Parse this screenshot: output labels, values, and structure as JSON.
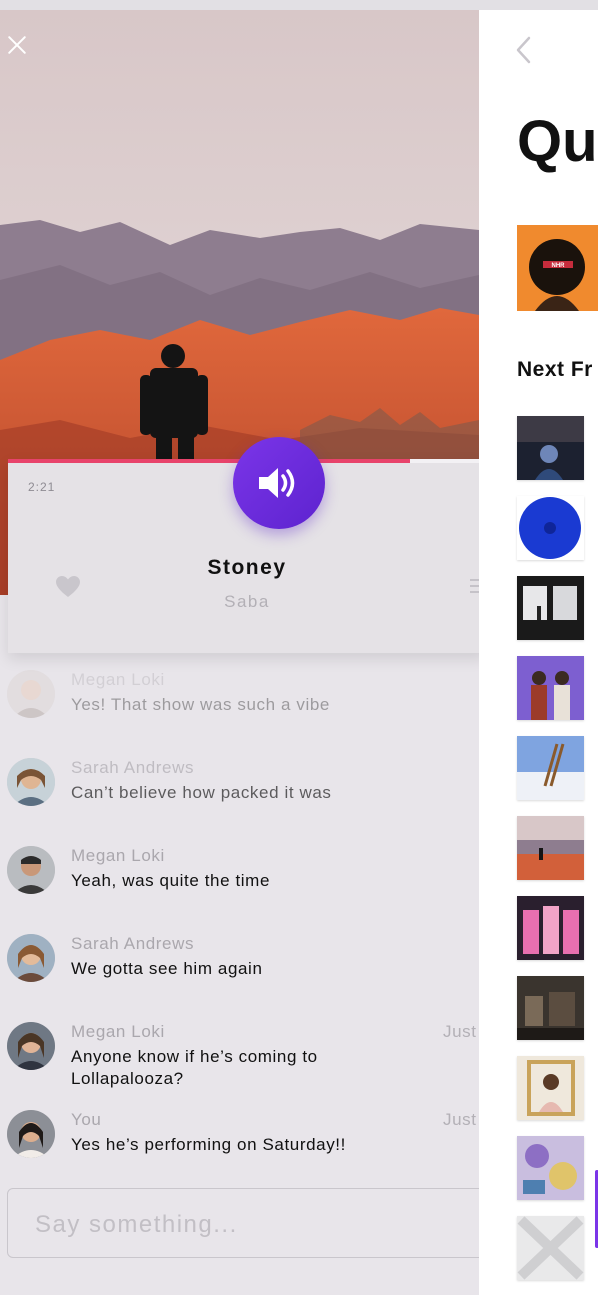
{
  "player": {
    "elapsed": "2:21",
    "progress": 0.84,
    "track_title": "Stoney",
    "track_artist": "Saba"
  },
  "chat": {
    "messages": [
      {
        "name": "Megan Loki",
        "text": "Yes! That show was such a vibe",
        "stamp": ""
      },
      {
        "name": "Sarah Andrews",
        "text": "Can’t believe how packed it was",
        "stamp": ""
      },
      {
        "name": "Megan Loki",
        "text": "Yeah, was quite the time",
        "stamp": ""
      },
      {
        "name": "Sarah Andrews",
        "text": "We gotta see him again",
        "stamp": ""
      },
      {
        "name": "Megan Loki",
        "text": "Anyone know if he’s coming to Lollapalooza?",
        "stamp": "Just"
      },
      {
        "name": "You",
        "text": "Yes he’s performing on Saturday!!",
        "stamp": "Just"
      }
    ],
    "input_placeholder": "Say something..."
  },
  "queue": {
    "title": "Qu",
    "next_from_label": "Next Fr",
    "now_playing_cover_text": "NHR",
    "thumbnails": [
      "album-cover-1",
      "album-cover-2",
      "album-cover-3",
      "album-cover-4",
      "album-cover-5",
      "album-cover-6",
      "album-cover-7",
      "album-cover-8",
      "album-cover-9",
      "album-cover-10",
      "album-cover-11"
    ]
  },
  "colors": {
    "accent_purple": "#6a2ddb",
    "progress_pink": "#e8436b",
    "background": "#e8e5ea"
  },
  "icons": [
    "close-icon",
    "speaker-icon",
    "heart-icon",
    "menu-icon",
    "back-chevron-icon"
  ]
}
